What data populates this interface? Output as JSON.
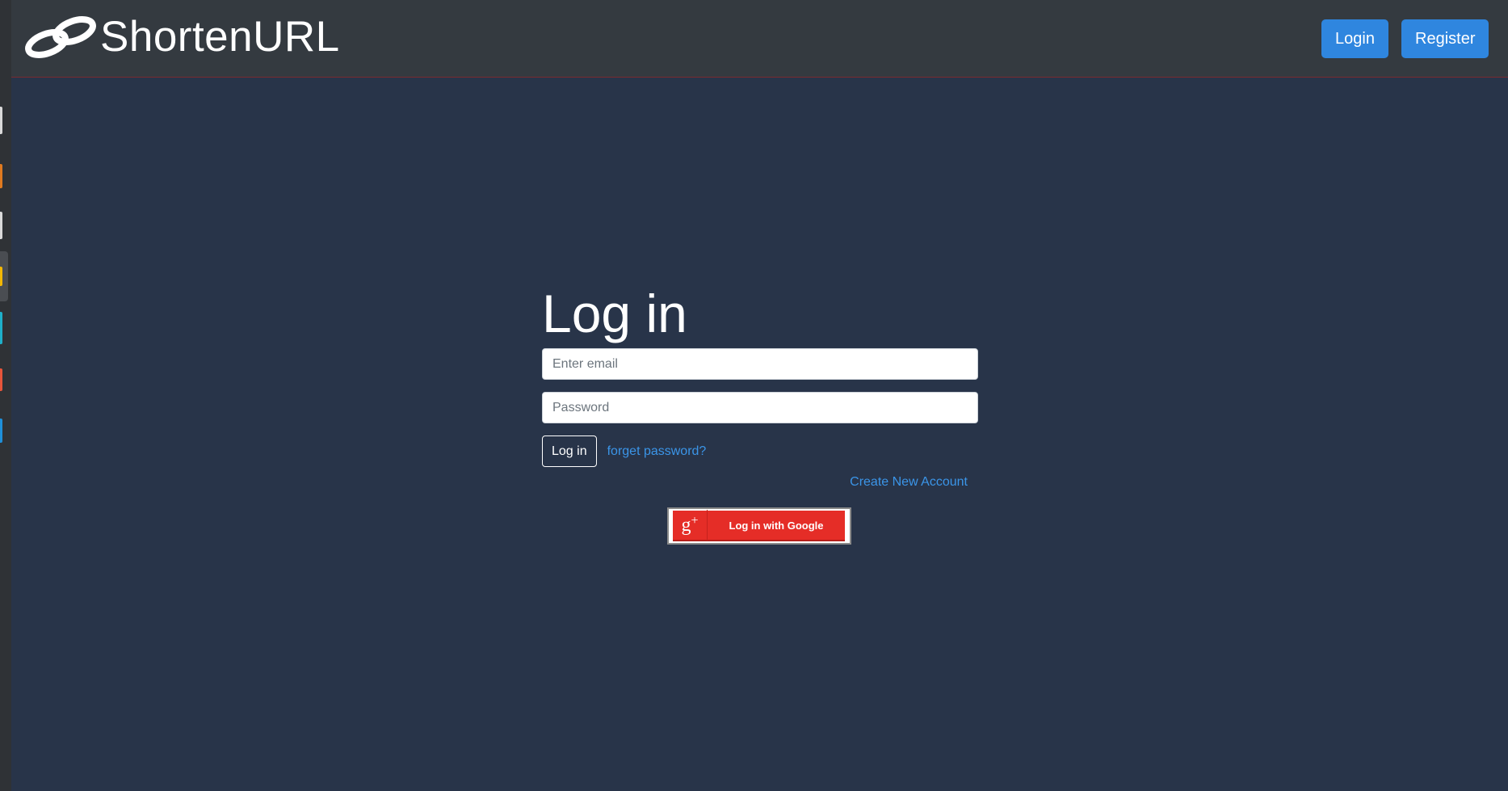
{
  "brand": {
    "name": "ShortenURL",
    "icon": "link-chain-icon"
  },
  "nav": {
    "login_label": "Login",
    "register_label": "Register"
  },
  "login_form": {
    "title": "Log in",
    "email_placeholder": "Enter email",
    "password_placeholder": "Password",
    "submit_label": "Log in",
    "forgot_label": "forget password?",
    "create_account_label": "Create New Account",
    "google_icon": "google-plus-icon",
    "google_label": "Log in with Google"
  },
  "colors": {
    "page_bg": "#283449",
    "navbar_bg": "#343a40",
    "primary_button": "#2f86df",
    "link": "#3b95e8",
    "google_red": "#e52d27"
  }
}
